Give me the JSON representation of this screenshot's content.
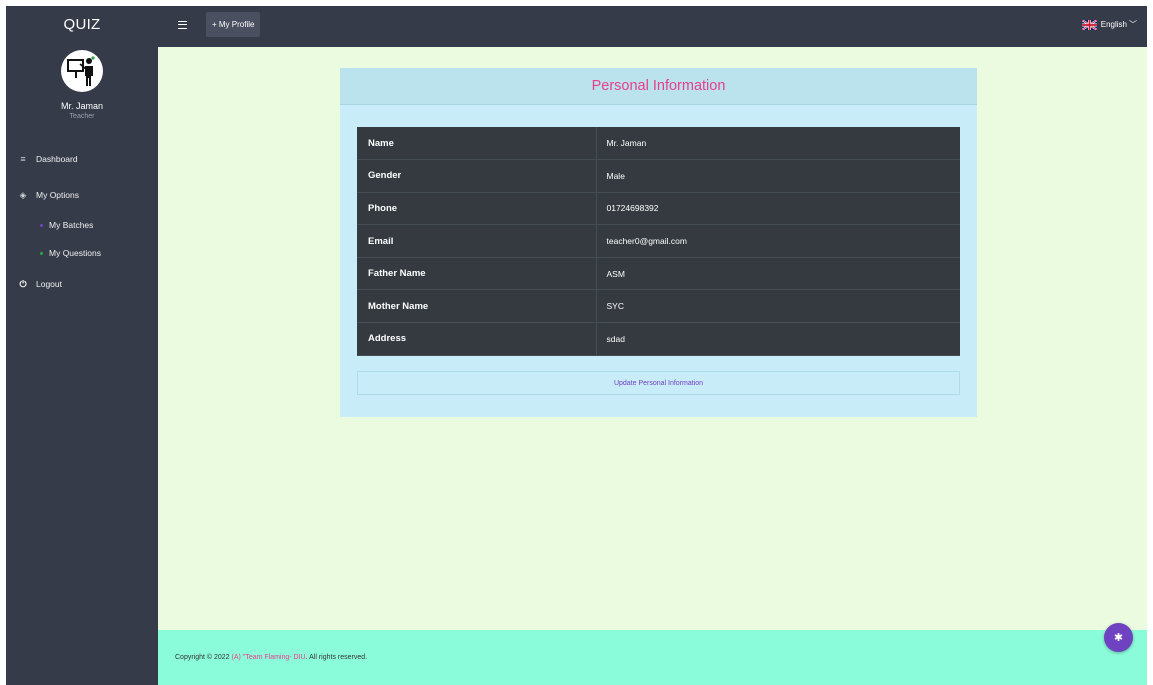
{
  "app": {
    "brand": "QUIZ"
  },
  "user": {
    "name": "Mr. Jaman",
    "role": "Teacher"
  },
  "sidebar": {
    "items": [
      {
        "label": "Dashboard",
        "icon": "menu-icon"
      },
      {
        "label": "My Options",
        "icon": "layers-icon"
      },
      {
        "label": "My Batches",
        "icon": "dot",
        "dot_color": "#6f42c1"
      },
      {
        "label": "My Questions",
        "icon": "dot",
        "dot_color": "#28a745"
      },
      {
        "label": "Logout",
        "icon": "power-icon"
      }
    ]
  },
  "topbar": {
    "profile_button": "+ My Profile",
    "language": "English"
  },
  "card": {
    "title": "Personal Information",
    "rows": [
      {
        "label": "Name",
        "value": "Mr. Jaman"
      },
      {
        "label": "Gender",
        "value": "Male"
      },
      {
        "label": "Phone",
        "value": "01724698392"
      },
      {
        "label": "Email",
        "value": "teacher0@gmail.com"
      },
      {
        "label": "Father Name",
        "value": "ASM"
      },
      {
        "label": "Mother Name",
        "value": "SYC"
      },
      {
        "label": "Address",
        "value": "sdad"
      }
    ],
    "update_button": "Update Personal Information"
  },
  "footer": {
    "prefix": "Copyright © 2022",
    "icon": "(A)",
    "brand": "\"Team Flaming- DIU",
    "suffix": ". All rights reserved."
  },
  "colors": {
    "sidebar_bg": "#353b48",
    "main_bg": "#eafbdf",
    "card_bg": "#c8ecf8",
    "title_color": "#e83e8c",
    "table_bg": "#343a40",
    "footer_bg": "#8bfcd9",
    "fab_bg": "#6f42c1"
  }
}
